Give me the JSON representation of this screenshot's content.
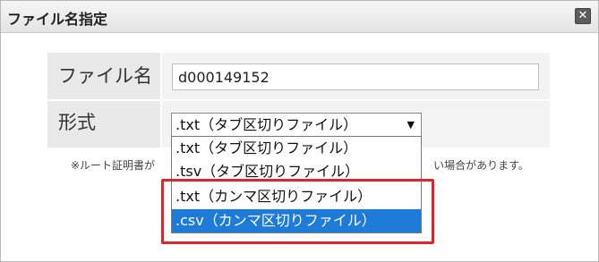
{
  "dialog": {
    "title": "ファイル名指定",
    "close_label": "✕"
  },
  "form": {
    "filename_label": "ファイル名",
    "filename_value": "d000149152",
    "format_label": "形式",
    "format_selected": ".txt（タブ区切りファイル）",
    "format_arrow": "▼",
    "options": [
      {
        "label": ".txt（タブ区切りファイル）",
        "selected": false
      },
      {
        "label": ".tsv（タブ区切りファイル）",
        "selected": false
      },
      {
        "label": ".txt（カンマ区切りファイル）",
        "selected": false
      },
      {
        "label": ".csv（カンマ区切りファイル）",
        "selected": true
      }
    ],
    "note_prefix": "※ルート証明書が",
    "note_suffix": "い場合があります。"
  },
  "colors": {
    "highlight": "#e0242b",
    "selected_option_bg": "#1e7bd8"
  }
}
